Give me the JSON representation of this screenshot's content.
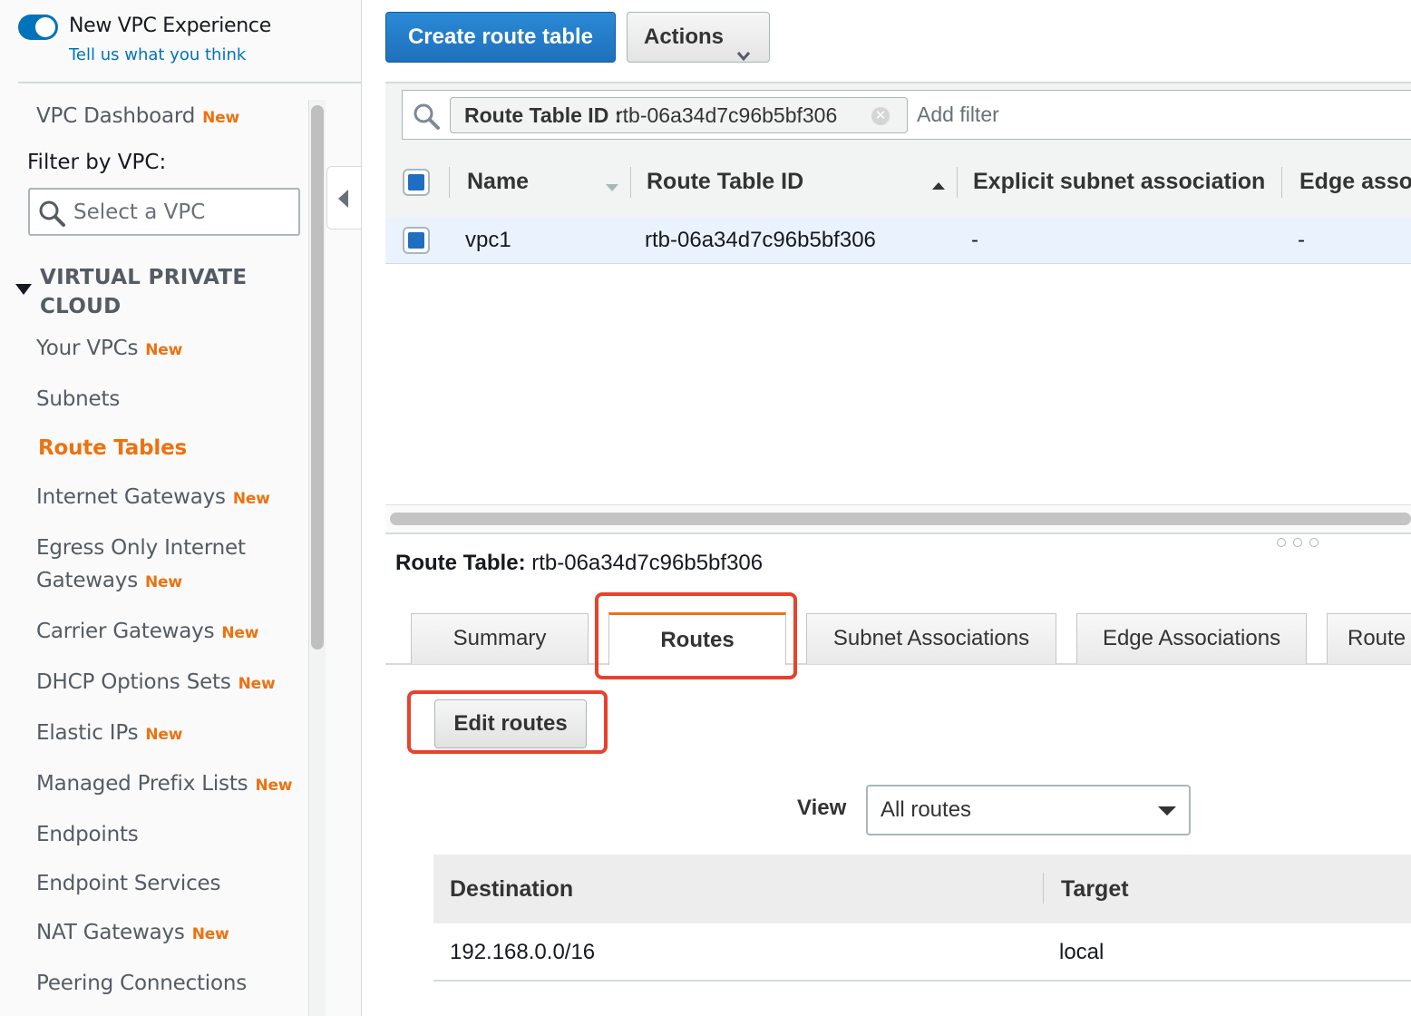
{
  "sidebar": {
    "toggle_label": "New VPC Experience",
    "feedback_link": "Tell us what you think",
    "dashboard": {
      "label": "VPC Dashboard",
      "badge": "New"
    },
    "filter_label": "Filter by VPC:",
    "vpc_select_placeholder": "Select a VPC",
    "section_title_line1": "VIRTUAL PRIVATE",
    "section_title_line2": "CLOUD",
    "items": [
      {
        "label": "Your VPCs",
        "badge": "New"
      },
      {
        "label": "Subnets",
        "badge": ""
      },
      {
        "label": "Route Tables",
        "badge": "",
        "active": true
      },
      {
        "label": "Internet Gateways",
        "badge": "New"
      },
      {
        "label_line1": "Egress Only Internet",
        "label_line2": "Gateways",
        "badge": "New"
      },
      {
        "label": "Carrier Gateways",
        "badge": "New"
      },
      {
        "label": "DHCP Options Sets",
        "badge": "New"
      },
      {
        "label": "Elastic IPs",
        "badge": "New"
      },
      {
        "label": "Managed Prefix Lists",
        "badge": "New"
      },
      {
        "label": "Endpoints",
        "badge": ""
      },
      {
        "label": "Endpoint Services",
        "badge": ""
      },
      {
        "label": "NAT Gateways",
        "badge": "New"
      },
      {
        "label": "Peering Connections",
        "badge": ""
      }
    ]
  },
  "toolbar": {
    "create_label": "Create route table",
    "actions_label": "Actions"
  },
  "filter": {
    "token_key": "Route Table ID",
    "token_sep": ":",
    "token_value": "rtb-06a34d7c96b5bf306",
    "add_filter_placeholder": "Add filter"
  },
  "table": {
    "columns": [
      "Name",
      "Route Table ID",
      "Explicit subnet association",
      "Edge asso"
    ],
    "rows": [
      {
        "name": "vpc1",
        "route_table_id": "rtb-06a34d7c96b5bf306",
        "explicit_subnet": "-",
        "edge": "-"
      }
    ]
  },
  "detail": {
    "title_label": "Route Table:",
    "title_value": "rtb-06a34d7c96b5bf306",
    "tabs": [
      "Summary",
      "Routes",
      "Subnet Associations",
      "Edge Associations",
      "Route"
    ],
    "active_tab": "Routes",
    "edit_routes_label": "Edit routes",
    "view_label": "View",
    "view_value": "All routes",
    "routes_columns": [
      "Destination",
      "Target"
    ],
    "routes": [
      {
        "destination": "192.168.0.0/16",
        "target": "local"
      }
    ]
  },
  "colors": {
    "accent_orange": "#ec7211",
    "primary_blue": "#1f70bc",
    "link_blue": "#0073bb",
    "highlight_red": "#e8412c",
    "selected_row": "#eaf3fd"
  }
}
